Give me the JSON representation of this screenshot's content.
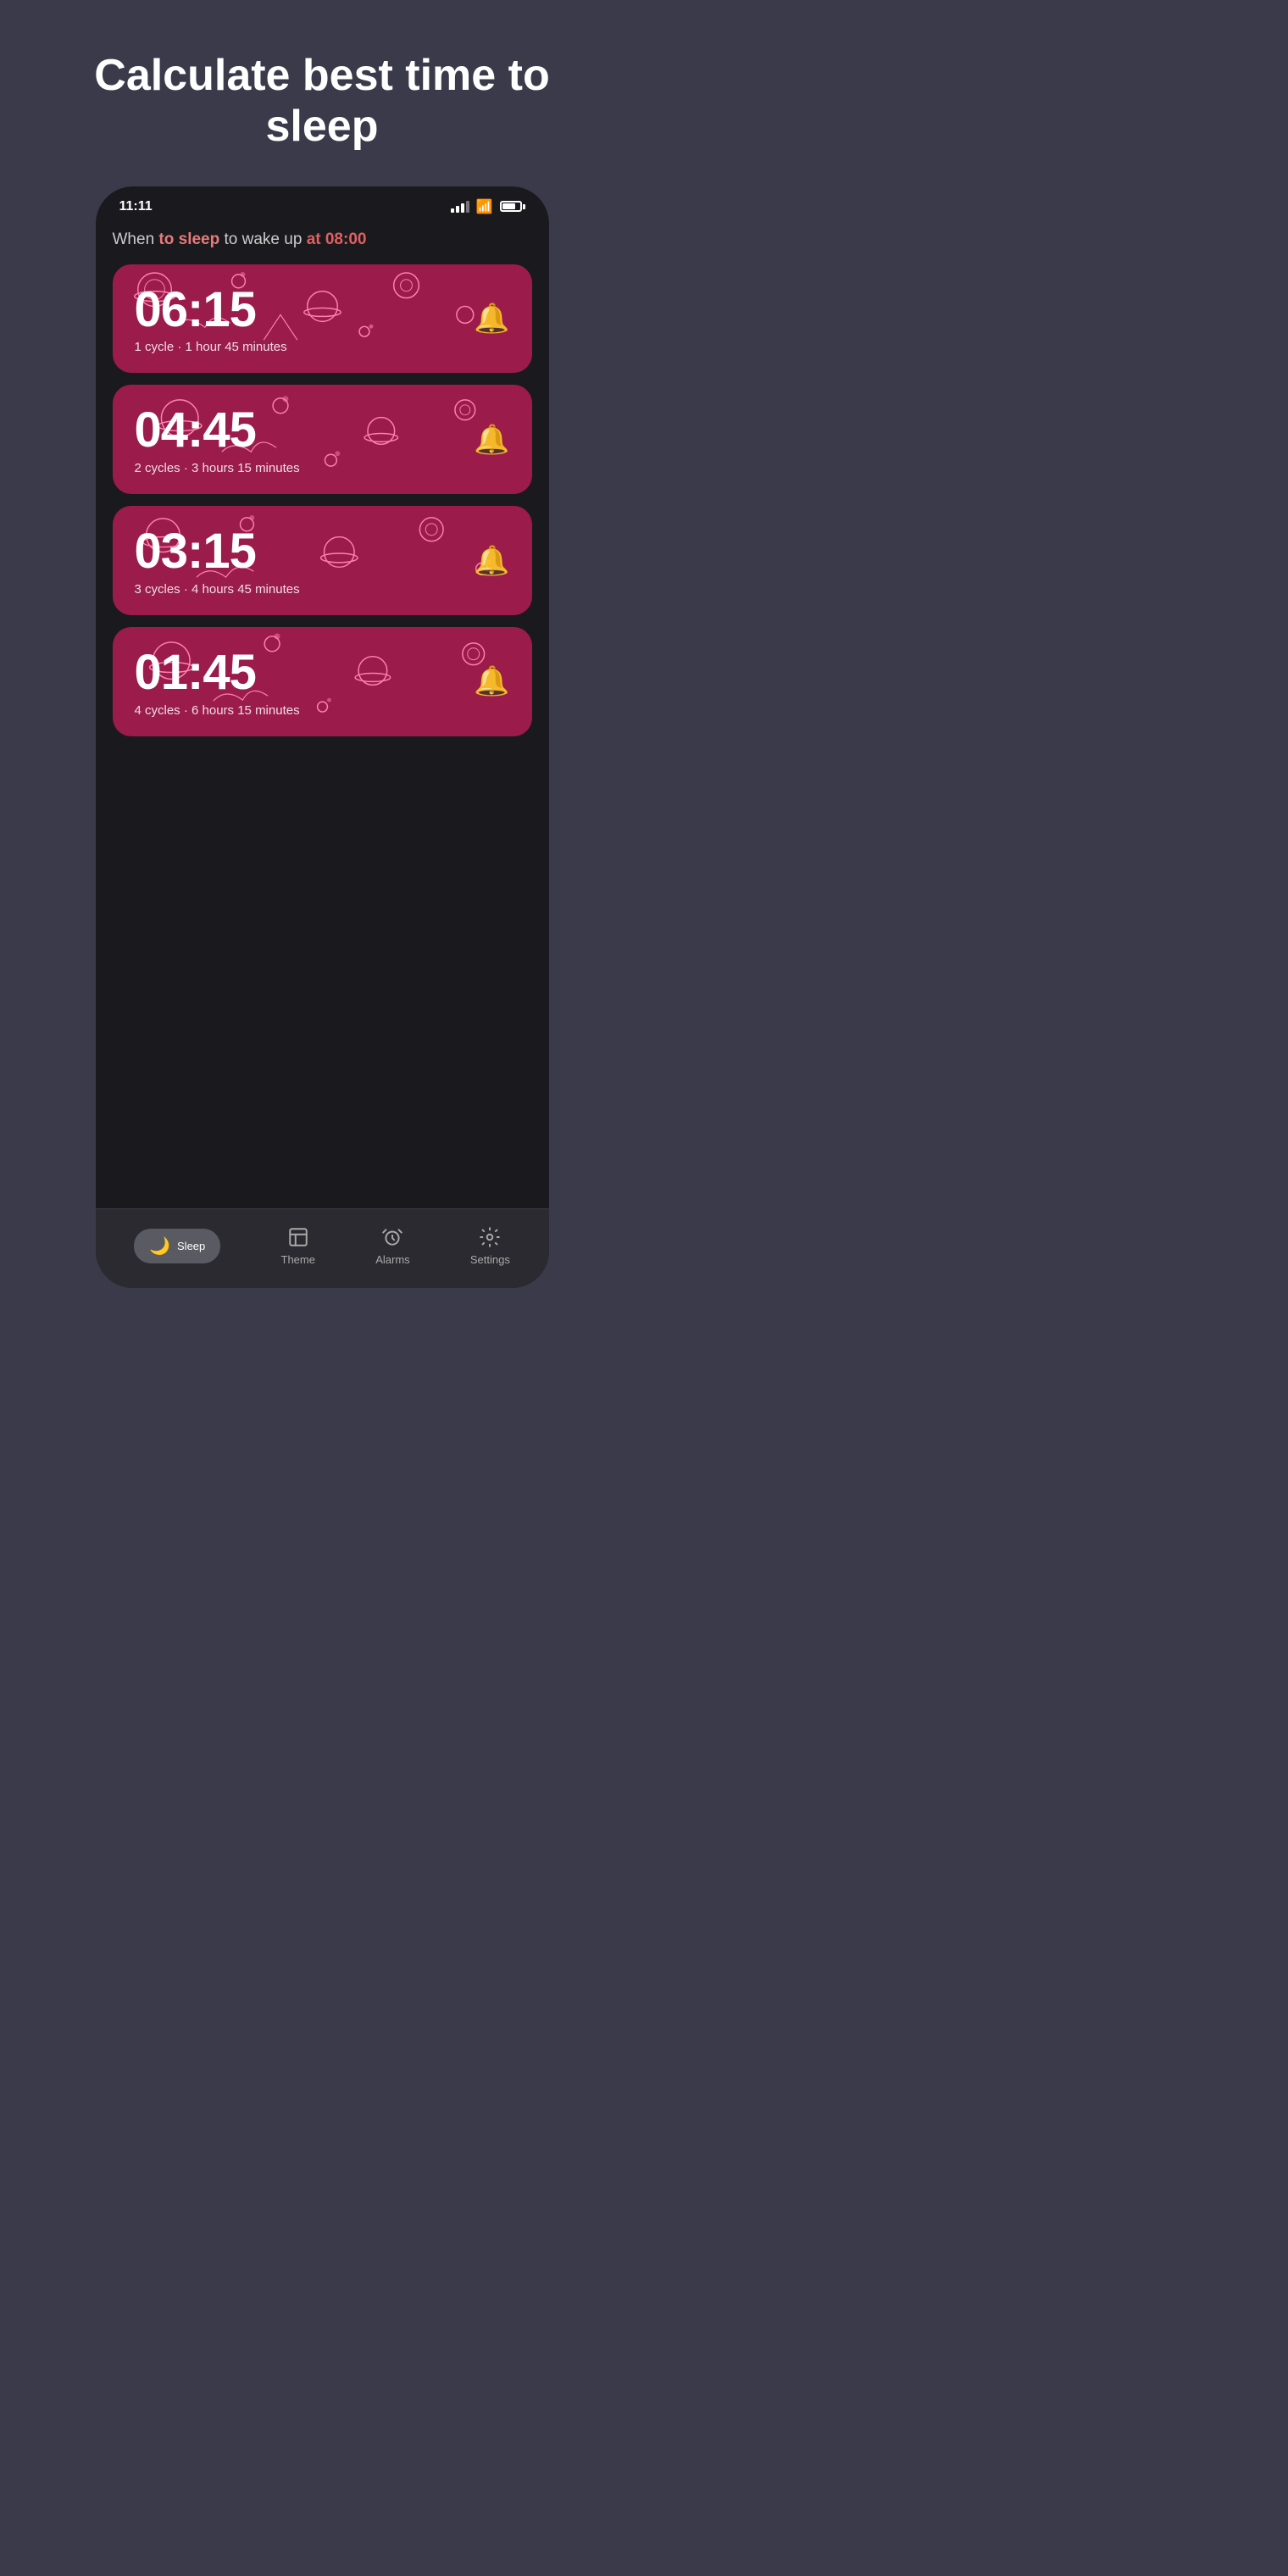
{
  "hero": {
    "title": "Calculate best time to sleep"
  },
  "statusBar": {
    "time": "11:11"
  },
  "wakeText": {
    "prefix": "When ",
    "highlight1": "to sleep",
    "middle": " to wake up ",
    "highlight2": "at 08:00"
  },
  "cards": [
    {
      "time": "06:15",
      "cycles": "1 cycle · 1 hour 45 minutes"
    },
    {
      "time": "04:45",
      "cycles": "2 cycles · 3 hours 15 minutes"
    },
    {
      "time": "03:15",
      "cycles": "3 cycles · 4 hours 45 minutes"
    },
    {
      "time": "01:45",
      "cycles": "4 cycles · 6 hours 15 minutes"
    }
  ],
  "nav": {
    "items": [
      {
        "label": "Sleep",
        "icon": "🌙",
        "active": true
      },
      {
        "label": "Theme",
        "icon": "🎨",
        "active": false
      },
      {
        "label": "Alarms",
        "icon": "⏰",
        "active": false
      },
      {
        "label": "Settings",
        "icon": "⚙️",
        "active": false
      }
    ]
  }
}
